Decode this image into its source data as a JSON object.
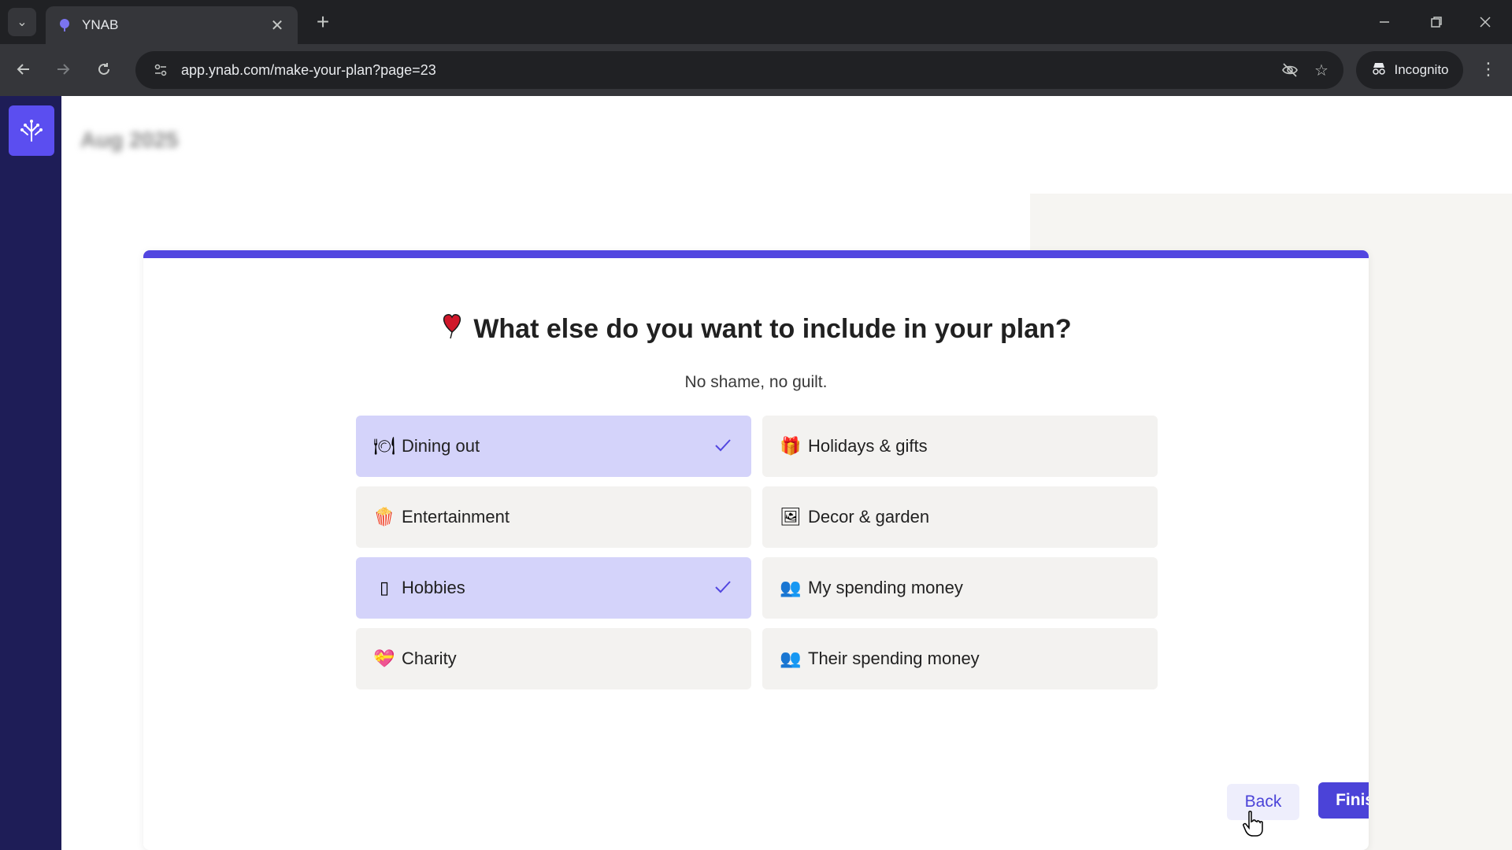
{
  "browser": {
    "tab_title": "YNAB",
    "url": "app.ynab.com/make-your-plan?page=23",
    "incognito_label": "Incognito",
    "tab_close_glyph": "✕",
    "new_tab_glyph": "+",
    "icons": [
      "tab-list-icon",
      "ynab-favicon",
      "back-icon",
      "forward-icon",
      "reload-icon",
      "site-info-icon",
      "eye-off-icon",
      "star-icon",
      "incognito-icon",
      "more-menu-icon",
      "minimize-icon",
      "restore-icon",
      "close-window-icon"
    ]
  },
  "app": {
    "month_title": "Aug 2025",
    "accent_color": "#5246e0",
    "sidebar_color": "#1e1d57",
    "selected_color": "#d4d3fa"
  },
  "modal": {
    "heading": "What else do you want to include in your plan?",
    "subheading": "No shame, no guilt.",
    "options": [
      {
        "label": "Dining out",
        "icon": "🍽",
        "selected": true
      },
      {
        "label": "Holidays & gifts",
        "icon": "🎁",
        "selected": false
      },
      {
        "label": "Entertainment",
        "icon": "🍿",
        "selected": false
      },
      {
        "label": "Decor & garden",
        "icon": "🖼",
        "selected": false
      },
      {
        "label": "Hobbies",
        "icon": "▯",
        "selected": true
      },
      {
        "label": "My spending money",
        "icon": "👥",
        "selected": false
      },
      {
        "label": "Charity",
        "icon": "💝",
        "selected": false
      },
      {
        "label": "Their spending money",
        "icon": "👥",
        "selected": false
      }
    ],
    "back_label": "Back",
    "finish_label": "Finish"
  }
}
